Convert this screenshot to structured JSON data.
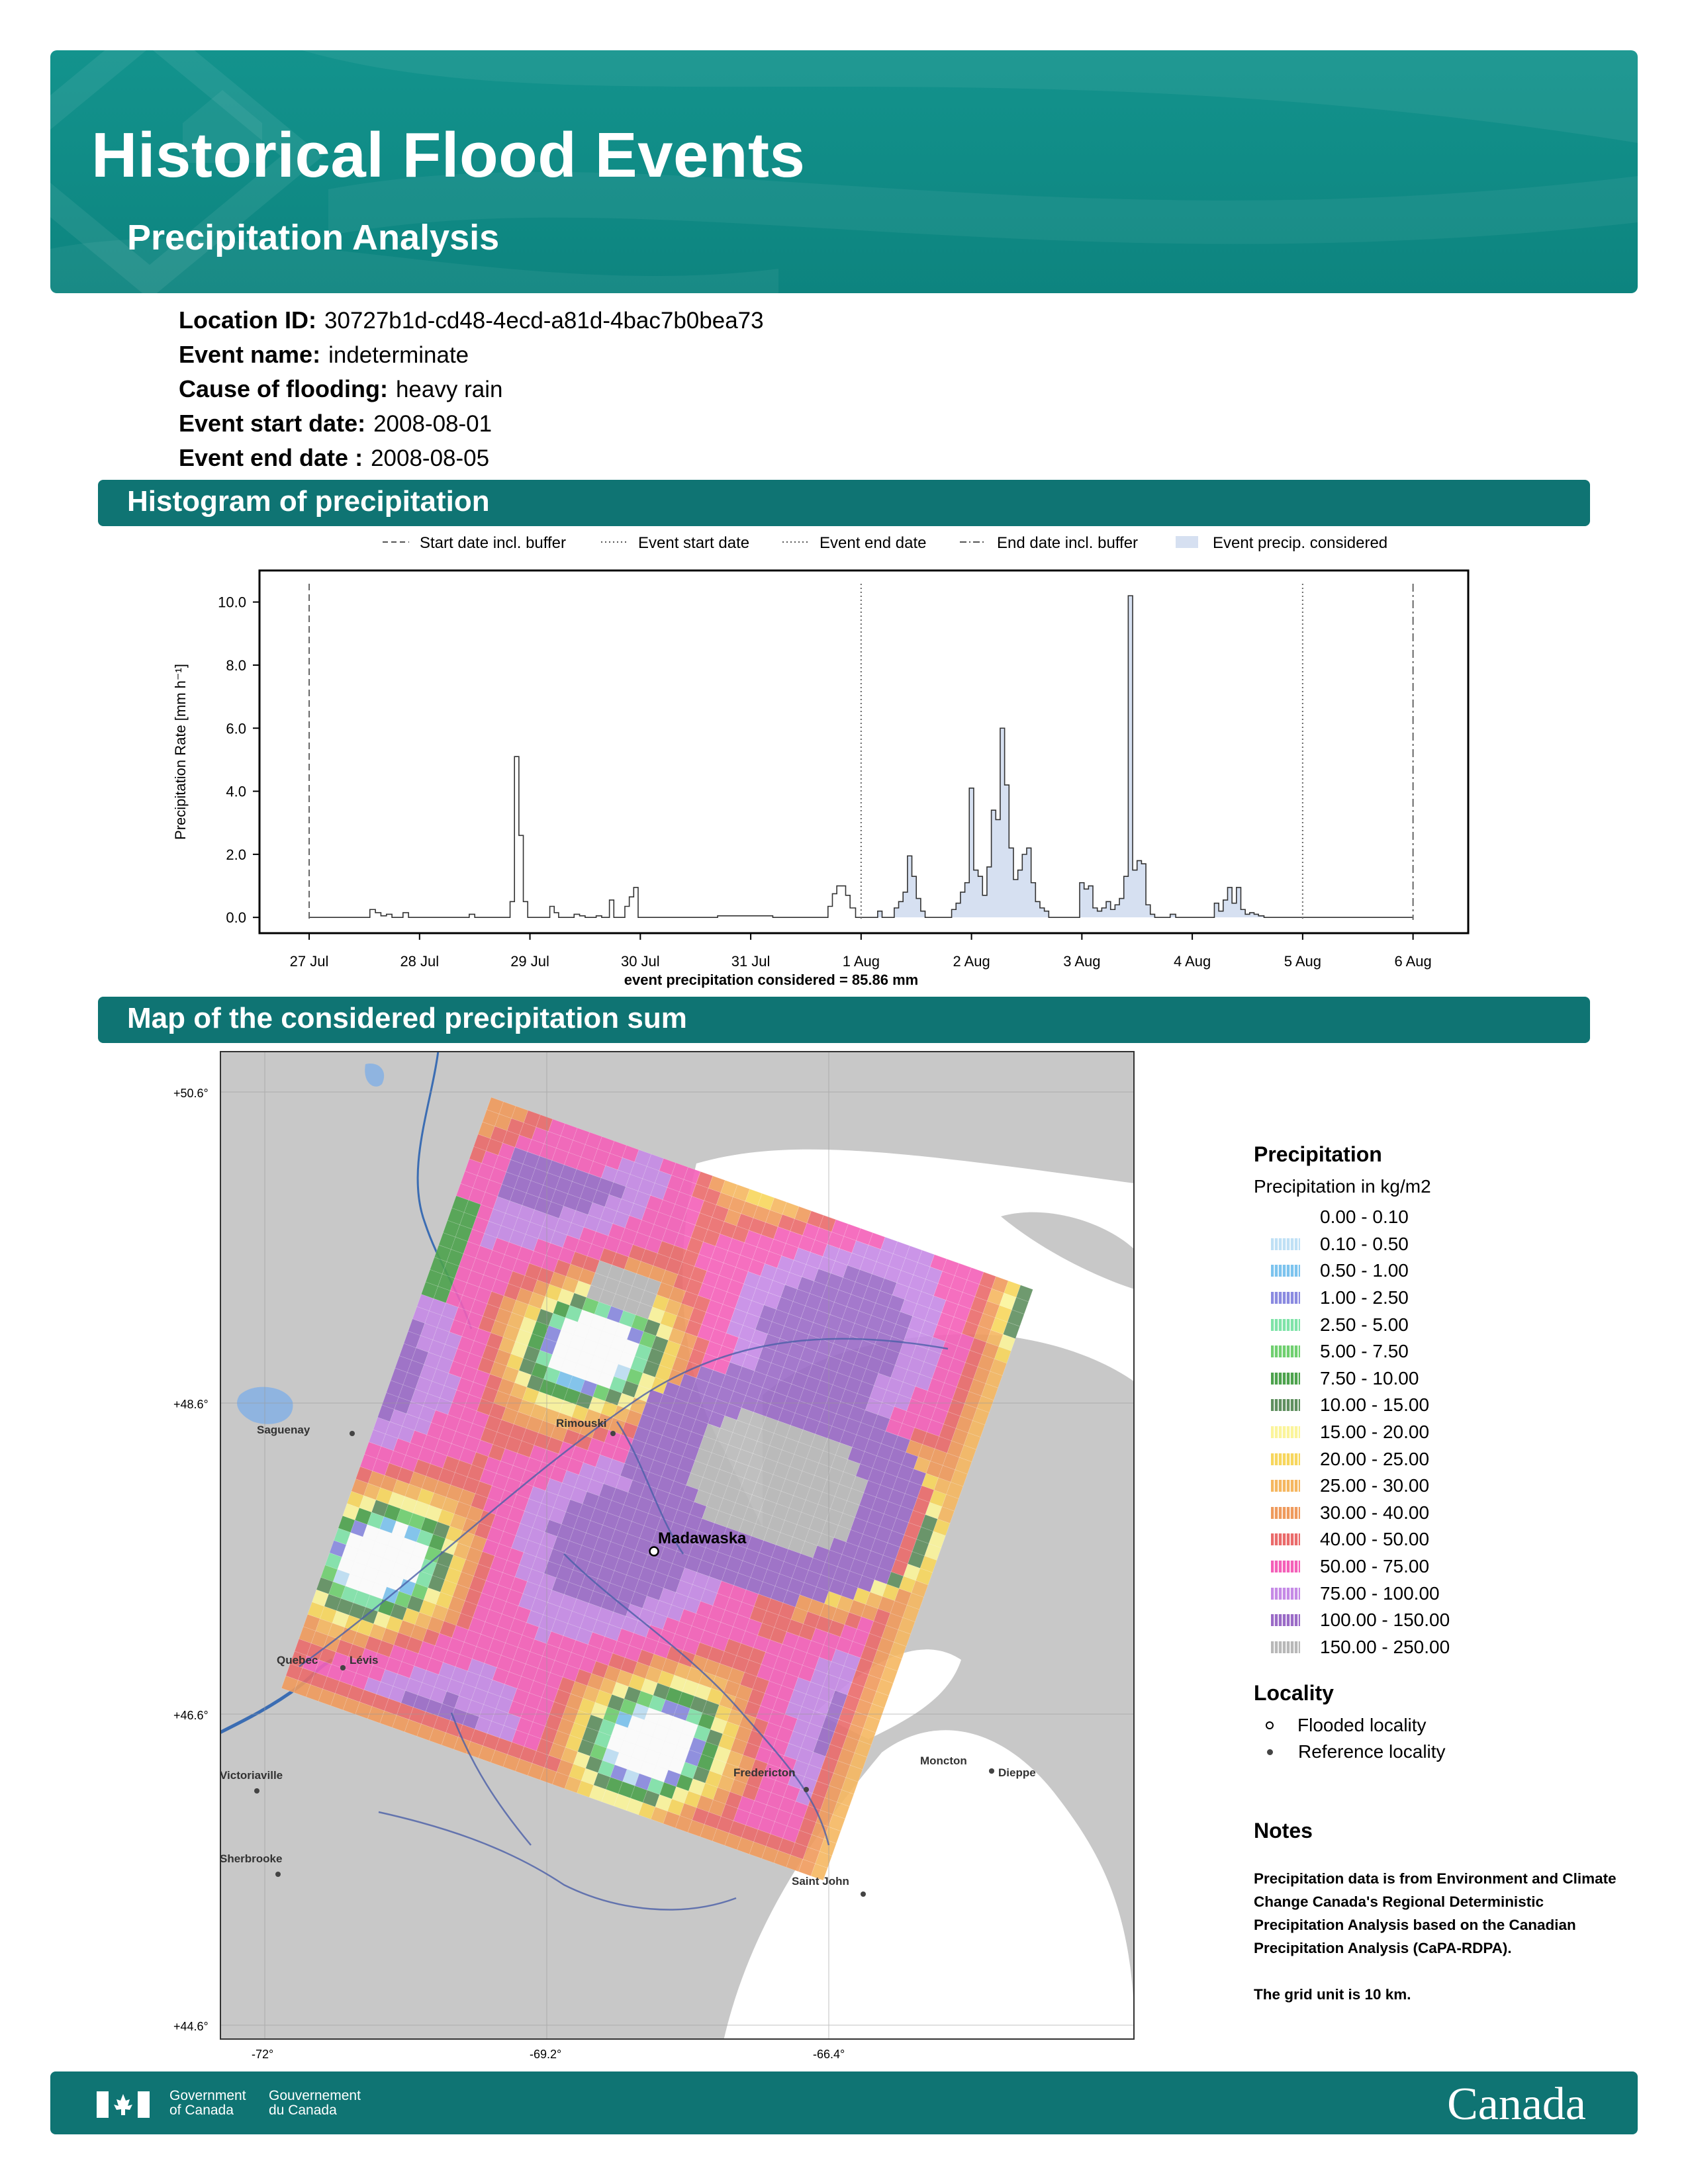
{
  "header": {
    "title": "Historical Flood Events",
    "subtitle": "Precipitation Analysis"
  },
  "event_info": [
    {
      "label": "Location ID:",
      "value": "30727b1d-cd48-4ecd-a81d-4bac7b0bea73"
    },
    {
      "label": "Event name:",
      "value": "indeterminate"
    },
    {
      "label": "Cause of flooding:",
      "value": "heavy rain"
    },
    {
      "label": "Event start date:",
      "value": "2008-08-01"
    },
    {
      "label": "Event end date :",
      "value": "2008-08-05"
    }
  ],
  "sections": {
    "histogram": "Histogram of precipitation",
    "map": "Map of the considered precipitation sum"
  },
  "chart_data": {
    "type": "area",
    "ylabel": "Precipitation Rate [mm h⁻¹]",
    "xlabel": "event precipitation considered = 85.86 mm",
    "ylim": [
      -0.5,
      11.0
    ],
    "yticks": [
      "0.0",
      "2.0",
      "4.0",
      "6.0",
      "8.0",
      "10.0"
    ],
    "ytick_values": [
      0,
      2,
      4,
      6,
      8,
      10
    ],
    "x_tick_labels": [
      "27 Jul",
      "28 Jul",
      "29 Jul",
      "30 Jul",
      "31 Jul",
      "1 Aug",
      "2 Aug",
      "3 Aug",
      "4 Aug",
      "5 Aug",
      "6 Aug"
    ],
    "x_range_days": [
      -0.45,
      10.5
    ],
    "legend": [
      {
        "label": "Start date incl. buffer",
        "style": "dashed"
      },
      {
        "label": "Event start date",
        "style": "dotted"
      },
      {
        "label": "Event end date",
        "style": "dotted"
      },
      {
        "label": "End date incl. buffer",
        "style": "dashdot"
      },
      {
        "label": "Event precip. considered",
        "style": "fill"
      }
    ],
    "vlines": [
      {
        "day": 0,
        "style": "dashed"
      },
      {
        "day": 5,
        "style": "dotted"
      },
      {
        "day": 9,
        "style": "dotted"
      },
      {
        "day": 10,
        "style": "dashdot"
      }
    ],
    "fill_color": "#d6e0f1",
    "hourly_rate_series": [
      [
        0.5,
        0.0
      ],
      [
        0.55,
        0.25
      ],
      [
        0.6,
        0.15
      ],
      [
        0.65,
        0.05
      ],
      [
        0.7,
        0.1
      ],
      [
        0.75,
        0.0
      ],
      [
        0.85,
        0.15
      ],
      [
        0.9,
        0.0
      ],
      [
        1.45,
        0.1
      ],
      [
        1.5,
        0.0
      ],
      [
        1.82,
        0.5
      ],
      [
        1.86,
        5.1
      ],
      [
        1.9,
        2.6
      ],
      [
        1.94,
        0.5
      ],
      [
        1.98,
        0.0
      ],
      [
        2.18,
        0.35
      ],
      [
        2.22,
        0.15
      ],
      [
        2.26,
        0.0
      ],
      [
        2.4,
        0.1
      ],
      [
        2.45,
        0.05
      ],
      [
        2.5,
        0.0
      ],
      [
        2.6,
        0.05
      ],
      [
        2.65,
        0.0
      ],
      [
        2.72,
        0.55
      ],
      [
        2.76,
        0.0
      ],
      [
        2.86,
        0.35
      ],
      [
        2.9,
        0.65
      ],
      [
        2.94,
        0.95
      ],
      [
        2.98,
        0.0
      ],
      [
        3.7,
        0.05
      ],
      [
        4.2,
        0.0
      ],
      [
        4.7,
        0.35
      ],
      [
        4.74,
        0.75
      ],
      [
        4.78,
        1.0
      ],
      [
        4.82,
        1.0
      ],
      [
        4.86,
        0.7
      ],
      [
        4.9,
        0.3
      ],
      [
        4.95,
        0.0
      ],
      [
        5.15,
        0.2
      ],
      [
        5.19,
        0.0
      ],
      [
        5.3,
        0.3
      ],
      [
        5.34,
        0.5
      ],
      [
        5.38,
        0.8
      ],
      [
        5.42,
        1.95
      ],
      [
        5.46,
        1.3
      ],
      [
        5.5,
        0.6
      ],
      [
        5.54,
        0.2
      ],
      [
        5.58,
        0.0
      ],
      [
        5.82,
        0.25
      ],
      [
        5.86,
        0.45
      ],
      [
        5.9,
        0.8
      ],
      [
        5.94,
        1.1
      ],
      [
        5.98,
        4.1
      ],
      [
        6.02,
        1.5
      ],
      [
        6.06,
        1.3
      ],
      [
        6.1,
        0.7
      ],
      [
        6.14,
        1.6
      ],
      [
        6.18,
        3.4
      ],
      [
        6.22,
        3.1
      ],
      [
        6.26,
        6.0
      ],
      [
        6.3,
        4.2
      ],
      [
        6.34,
        2.2
      ],
      [
        6.38,
        1.2
      ],
      [
        6.42,
        1.5
      ],
      [
        6.46,
        2.0
      ],
      [
        6.5,
        2.2
      ],
      [
        6.54,
        1.1
      ],
      [
        6.58,
        0.5
      ],
      [
        6.62,
        0.3
      ],
      [
        6.66,
        0.2
      ],
      [
        6.7,
        0.0
      ],
      [
        6.98,
        1.1
      ],
      [
        7.02,
        0.9
      ],
      [
        7.06,
        1.0
      ],
      [
        7.1,
        0.3
      ],
      [
        7.14,
        0.2
      ],
      [
        7.18,
        0.3
      ],
      [
        7.22,
        0.5
      ],
      [
        7.26,
        0.25
      ],
      [
        7.3,
        0.4
      ],
      [
        7.34,
        0.6
      ],
      [
        7.38,
        1.3
      ],
      [
        7.42,
        10.2
      ],
      [
        7.46,
        1.5
      ],
      [
        7.5,
        1.8
      ],
      [
        7.54,
        1.7
      ],
      [
        7.58,
        0.4
      ],
      [
        7.62,
        0.1
      ],
      [
        7.66,
        0.0
      ],
      [
        7.8,
        0.1
      ],
      [
        7.85,
        0.0
      ],
      [
        8.2,
        0.45
      ],
      [
        8.24,
        0.2
      ],
      [
        8.28,
        0.55
      ],
      [
        8.32,
        0.95
      ],
      [
        8.36,
        0.45
      ],
      [
        8.4,
        0.95
      ],
      [
        8.44,
        0.25
      ],
      [
        8.48,
        0.1
      ],
      [
        8.52,
        0.15
      ],
      [
        8.56,
        0.1
      ],
      [
        8.6,
        0.05
      ],
      [
        8.65,
        0.0
      ]
    ]
  },
  "map": {
    "lat_labels": [
      "+50.6°",
      "+48.6°",
      "+46.6°",
      "+44.6°"
    ],
    "lon_labels": [
      "-72°",
      "-69.2°",
      "-66.4°"
    ],
    "localities": {
      "flooded": [
        {
          "name": "Madawaska"
        }
      ],
      "reference": [
        {
          "name": "Saguenay"
        },
        {
          "name": "Rimouski"
        },
        {
          "name": "Quebec"
        },
        {
          "name": "Lévis"
        },
        {
          "name": "Victoriaville"
        },
        {
          "name": "Sherbrooke"
        },
        {
          "name": "Fredericton"
        },
        {
          "name": "Moncton"
        },
        {
          "name": "Dieppe"
        },
        {
          "name": "Saint John"
        }
      ]
    },
    "grid_unit": "10 km"
  },
  "legend": {
    "title": "Precipitation",
    "subtitle": "Precipitation in kg/m2",
    "classes": [
      {
        "label": "0.00 - 0.10",
        "color": "#ffffff"
      },
      {
        "label": "0.10 - 0.50",
        "color": "#bfe0f5"
      },
      {
        "label": "0.50 - 1.00",
        "color": "#7cc3ee"
      },
      {
        "label": "1.00 - 2.50",
        "color": "#8a8ae0"
      },
      {
        "label": "2.50 - 5.00",
        "color": "#7fe3a8"
      },
      {
        "label": "5.00 - 7.50",
        "color": "#6fcf6f"
      },
      {
        "label": "7.50 - 10.00",
        "color": "#4ca24c"
      },
      {
        "label": "10.00 - 15.00",
        "color": "#5f8f5f"
      },
      {
        "label": "15.00 - 20.00",
        "color": "#fbf49a"
      },
      {
        "label": "20.00 - 25.00",
        "color": "#f7d65c"
      },
      {
        "label": "25.00 - 30.00",
        "color": "#f5b760"
      },
      {
        "label": "30.00 - 40.00",
        "color": "#ef9a5c"
      },
      {
        "label": "40.00 - 50.00",
        "color": "#ea6a6a"
      },
      {
        "label": "50.00 - 75.00",
        "color": "#f45fb8"
      },
      {
        "label": "75.00 - 100.00",
        "color": "#c58ae6"
      },
      {
        "label": "100.00 - 150.00",
        "color": "#9a6ac6"
      },
      {
        "label": "150.00 - 250.00",
        "color": "#b8b8b8"
      }
    ]
  },
  "locality_legend": {
    "title": "Locality",
    "flooded": "Flooded locality",
    "reference": "Reference locality"
  },
  "notes": {
    "title": "Notes",
    "text": "Precipitation data is from Environment and Climate Change Canada's Regional Deterministic Precipitation Analysis based on the Canadian Precipitation Analysis (CaPA-RDPA).",
    "grid": "The grid unit is 10 km."
  },
  "footer": {
    "gov_en_1": "Government",
    "gov_en_2": "of Canada",
    "gov_fr_1": "Gouvernement",
    "gov_fr_2": "du Canada",
    "wordmark": "Canada"
  },
  "colors": {
    "banner": "#0f8a85",
    "section_bar": "#0f7473",
    "event_fill": "#d6e0f1"
  }
}
